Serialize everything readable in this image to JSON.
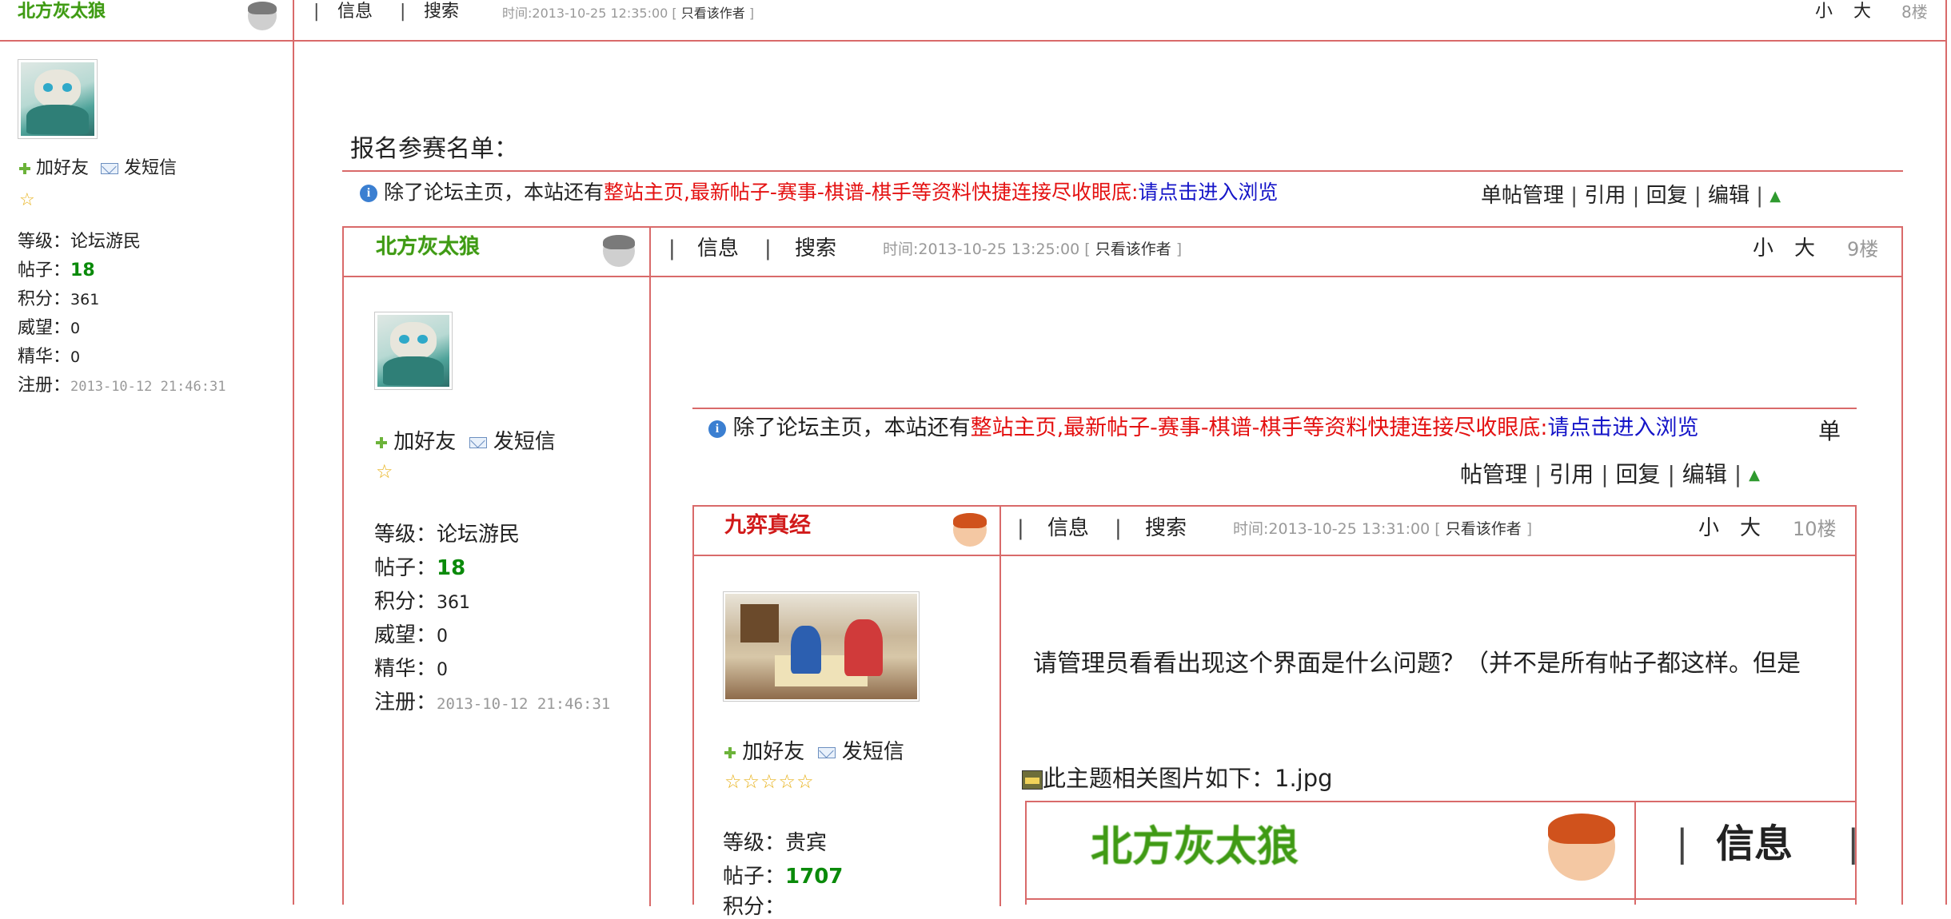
{
  "level1": {
    "username": "北方灰太狼",
    "nav": [
      "信息",
      "搜索"
    ],
    "time_text": "时间:2013-10-25 12:35:00",
    "only_author": "只看该作者",
    "font_small": "小",
    "font_large": "大",
    "floor": "8楼",
    "add_friend": "加好友",
    "send_msg": "发短信",
    "stars": "☆",
    "stats": {
      "level_label": "等级：",
      "level_value": "论坛游民",
      "posts_label": "帖子：",
      "posts_value": "18",
      "points_label": "积分：",
      "points_value": "361",
      "prestige_label": "威望：",
      "prestige_value": "0",
      "elite_label": "精华：",
      "elite_value": "0",
      "reg_label": "注册：",
      "reg_value": "2013-10-12 21:46:31"
    },
    "body_title": "报名参赛名单：",
    "notice_a": "除了论坛主页，本站还有",
    "notice_b": "整站主页,最新帖子-赛事-棋谱-棋手等资料快捷连接尽收眼底:",
    "notice_c": "请点击进入浏览",
    "actions": [
      "单帖管理",
      "引用",
      "回复",
      "编辑"
    ]
  },
  "level2": {
    "username": "北方灰太狼",
    "nav": [
      "信息",
      "搜索"
    ],
    "time_text": "时间:2013-10-25 13:25:00",
    "only_author": "只看该作者",
    "font_small": "小",
    "font_large": "大",
    "floor": "9楼",
    "add_friend": "加好友",
    "send_msg": "发短信",
    "stars": "☆",
    "stats": {
      "level_label": "等级：",
      "level_value": "论坛游民",
      "posts_label": "帖子：",
      "posts_value": "18",
      "points_label": "积分：",
      "points_value": "361",
      "prestige_label": "威望：",
      "prestige_value": "0",
      "elite_label": "精华：",
      "elite_value": "0",
      "reg_label": "注册：",
      "reg_value": "2013-10-12 21:46:31"
    },
    "notice_a": "除了论坛主页，本站还有",
    "notice_b": "整站主页,最新帖子-赛事-棋谱-棋手等资料快捷连接尽收眼底:",
    "notice_c": "请点击进入浏览",
    "action_first": "单",
    "actions": [
      "帖管理",
      "引用",
      "回复",
      "编辑"
    ]
  },
  "level3": {
    "username": "九弈真经",
    "nav": [
      "信息",
      "搜索"
    ],
    "time_text": "时间:2013-10-25 13:31:00",
    "only_author": "只看该作者",
    "font_small": "小",
    "font_large": "大",
    "floor": "10楼",
    "add_friend": "加好友",
    "send_msg": "发短信",
    "stars": "☆☆☆☆☆",
    "stats": {
      "level_label": "等级：",
      "level_value": "贵宾",
      "posts_label": "帖子：",
      "posts_value": "1707",
      "points_label": "积分："
    },
    "body_text": "请管理员看看出现这个界面是什么问题？（并不是所有帖子都这样。但是",
    "attach_text": "此主题相关图片如下：1.jpg",
    "embedded_username": "北方灰太狼",
    "embedded_nav": "信息"
  }
}
